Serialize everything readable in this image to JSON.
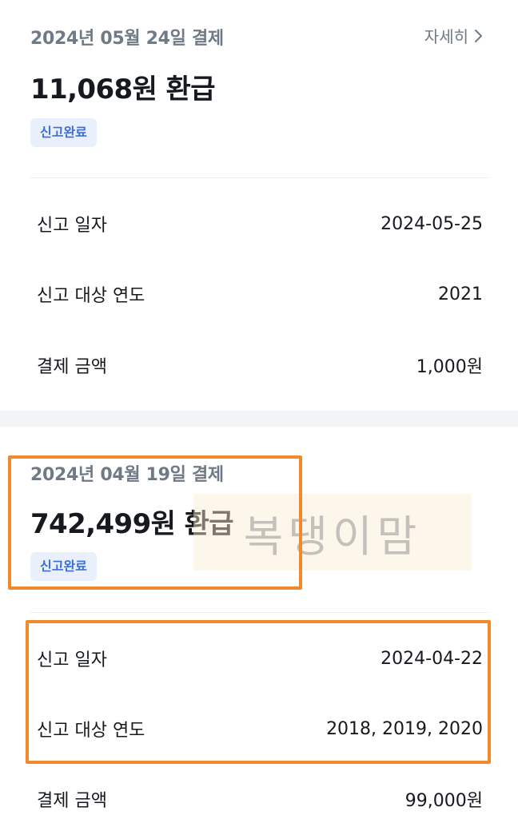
{
  "cards": [
    {
      "date": "2024년 05월 24일 결제",
      "detail_link": "자세히",
      "amount": "11,068원 환급",
      "badge": "신고완료",
      "rows": [
        {
          "label": "신고 일자",
          "value": "2024-05-25"
        },
        {
          "label": "신고 대상 연도",
          "value": "2021"
        },
        {
          "label": "결제 금액",
          "value": "1,000원"
        }
      ]
    },
    {
      "date": "2024년 04월 19일 결제",
      "amount": "742,499원 환급",
      "badge": "신고완료",
      "rows": [
        {
          "label": "신고 일자",
          "value": "2024-04-22"
        },
        {
          "label": "신고 대상 연도",
          "value": "2018, 2019, 2020"
        },
        {
          "label": "결제 금액",
          "value": "99,000원"
        }
      ]
    }
  ],
  "watermark": "복댕이맘",
  "colors": {
    "highlight": "#f08a2c",
    "badge_bg": "#e9f0fc",
    "badge_text": "#3c6fd6",
    "muted_text": "#6f7a86",
    "section_gap": "#f2f3f5"
  },
  "icons": {
    "detail_chevron": "chevron-right-icon"
  }
}
